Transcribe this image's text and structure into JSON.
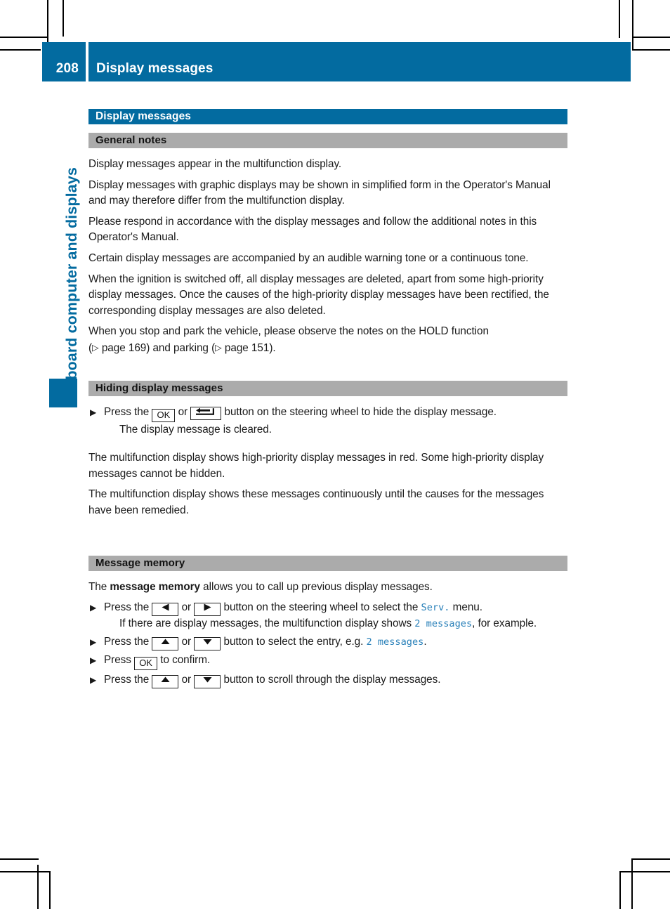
{
  "header": {
    "folio": "208",
    "title": "Display messages"
  },
  "chapter_tab": {
    "label": "On-board computer and displays"
  },
  "colors": {
    "accent_blue": "#036BA0",
    "section_gray": "#ABABAB",
    "mfd_text_blue": "#2980B9"
  },
  "sections": [
    {
      "id": "display-messages",
      "kind": "blue-bar",
      "heading": "Display messages"
    },
    {
      "id": "general-notes",
      "kind": "gray-bar",
      "heading": "General notes",
      "paragraphs": [
        "Display messages appear in the multifunction display.",
        "Display messages with graphic displays may be shown in simplified form in the Operator's Manual and may therefore differ from the multifunction display.",
        "Please respond in accordance with the display messages and follow the additional notes in this Operator's Manual.",
        "Certain display messages are accompanied by an audible warning tone or a continuous tone.",
        "When the ignition is switched off, all display messages are deleted, apart from some high-priority display messages. Once the causes of the high-priority display messages have been rectified, the corresponding display messages are also deleted."
      ],
      "hold_paragraph": {
        "lead": "When you stop and park the vehicle, please observe the notes on the HOLD function",
        "ref1_open": "(",
        "ref1_label": "page 169",
        "ref1_close": ") and parking (",
        "ref2_label": "page 151",
        "ref2_close": ").",
        "ref_icon": "page-reference-triangle-icon"
      }
    },
    {
      "id": "hiding-display-messages",
      "kind": "gray-bar",
      "heading": "Hiding display messages",
      "steps": [
        {
          "marker": "step-triangle-icon",
          "pre": "Press the",
          "key1": "OK",
          "key1_name": "ok-key-icon",
          "between": "or",
          "key2_name": "back-key-icon",
          "post": "button on the steering wheel to hide the display message.",
          "sub": "The display message is cleared."
        }
      ],
      "paragraphs": [
        "The multifunction display shows high-priority display messages in red. Some high-priority display messages cannot be hidden.",
        "The multifunction display shows these messages continuously until the causes for the messages have been remedied."
      ]
    },
    {
      "id": "message-memory",
      "kind": "gray-bar",
      "heading": "Message memory",
      "intro": {
        "part1": "The ",
        "bold": "message memory",
        "part2": " allows you to call up previous display messages."
      },
      "steps": [
        {
          "marker": "step-triangle-icon",
          "pre": "Press the",
          "key1_name": "left-arrow-key-icon",
          "between": "or",
          "key2_name": "right-arrow-key-icon",
          "post1": "button on the steering wheel to select the",
          "mfd1": "Serv.",
          "post2": "menu.",
          "sub_pre": "If there are display messages, the multifunction display shows ",
          "sub_mfd": "2 messages",
          "sub_post": ", for example."
        },
        {
          "marker": "step-triangle-icon",
          "pre": "Press the",
          "key1_name": "up-arrow-key-icon",
          "between": "or",
          "key2_name": "down-arrow-key-icon",
          "post1": "button to select the entry, e.g. ",
          "mfd1": "2 messages",
          "post2": "."
        },
        {
          "marker": "step-triangle-icon",
          "pre": "Press",
          "key1": "OK",
          "key1_name": "ok-key-icon",
          "post1": "to confirm."
        },
        {
          "marker": "step-triangle-icon",
          "pre": "Press the",
          "key1_name": "up-arrow-key-icon",
          "between": "or",
          "key2_name": "down-arrow-key-icon",
          "post1": "button to scroll through the display messages."
        }
      ]
    }
  ]
}
